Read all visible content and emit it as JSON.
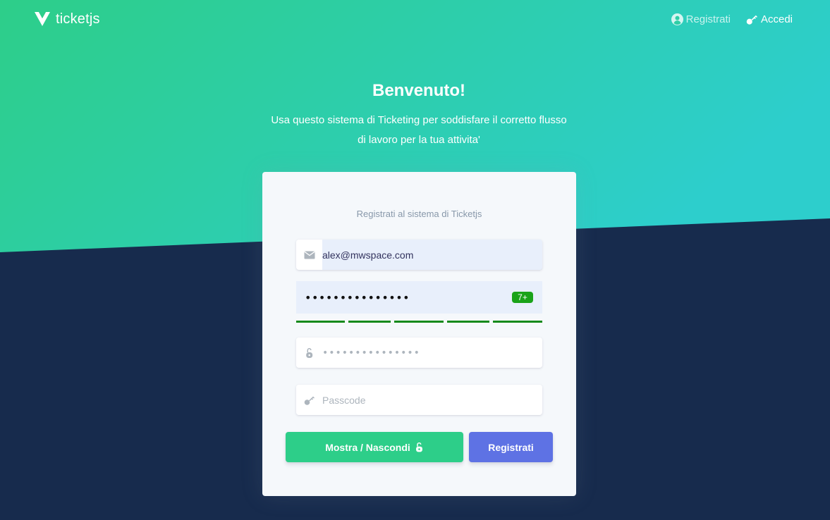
{
  "colors": {
    "gradient_start": "#2dce89",
    "gradient_end": "#2dcecc",
    "dark_bg": "#172b4d",
    "card_bg": "#f5f8fb",
    "success": "#2dce89",
    "primary": "#5e72e4",
    "strength": "#168a1c"
  },
  "navbar": {
    "brand": "ticketjs",
    "logo_icon": "vue-logo-icon",
    "links": [
      {
        "label": "Registrati",
        "icon": "user-circle-icon",
        "active": false
      },
      {
        "label": "Accedi",
        "icon": "key-icon",
        "active": true
      }
    ]
  },
  "header": {
    "title": "Benvenuto!",
    "lead_line1": "Usa questo sistema di Ticketing per soddisfare il corretto flusso",
    "lead_line2": "di lavoro per la tua attivita'"
  },
  "form": {
    "subtitle": "Registrati al sistema di Ticketjs",
    "email": {
      "value": "alex@mwspace.com",
      "icon": "envelope-icon"
    },
    "password": {
      "value": "•••••••••••••••",
      "strength_label": "7+",
      "strength_segments_filled": 5
    },
    "confirm_password": {
      "placeholder": "•••••••••••••••",
      "icon": "unlock-icon"
    },
    "passcode": {
      "placeholder": "Passcode",
      "icon": "key-icon"
    },
    "toggle_button": {
      "label": "Mostra / Nascondi",
      "icon": "unlock-icon"
    },
    "register_button": {
      "label": "Registrati"
    }
  }
}
